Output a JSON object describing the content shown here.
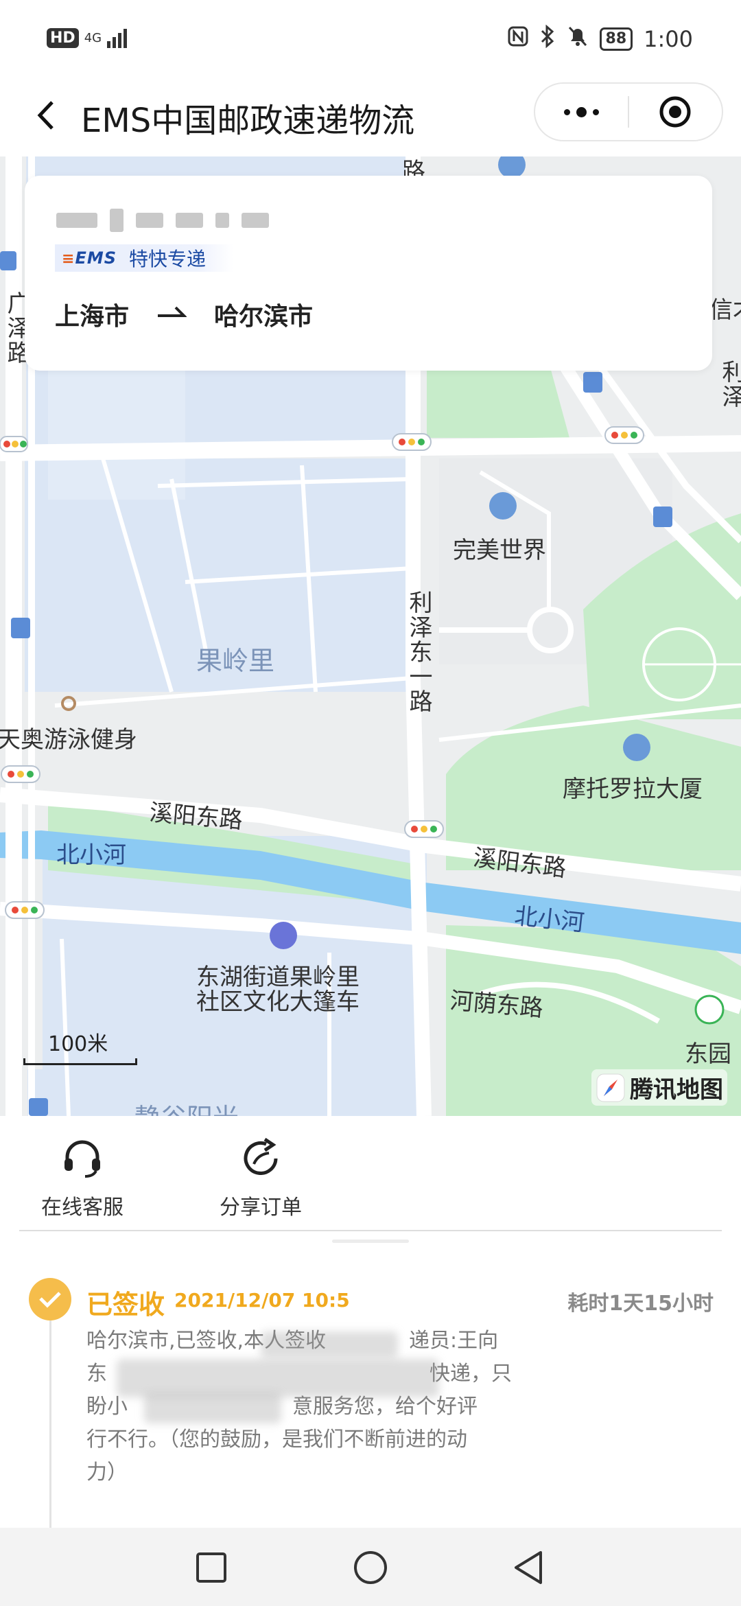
{
  "status_bar": {
    "hd": "HD",
    "network": "4G",
    "battery": "88",
    "time": "1:00"
  },
  "title_bar": {
    "title": "EMS中国邮政速递物流"
  },
  "route_card": {
    "service_logo": "EMS",
    "service_name": "特快专递",
    "origin": "上海市",
    "destination": "哈尔滨市"
  },
  "map": {
    "labels": {
      "road_top": "路",
      "guang_ze_lu": "广泽路",
      "xin": "信才",
      "li": "利泽",
      "wanmei": "完美世界",
      "guolingli": "果岭里",
      "lize_dong_yi_lu": "利泽东一路",
      "tianao": "天奥游泳健身",
      "motorola": "摩托罗拉大厦",
      "xiyang_1": "溪阳东路",
      "xiyang_2": "溪阳东路",
      "river_1": "北小河",
      "river_2": "北小河",
      "donghu": "东湖街道果岭里",
      "donghu_2": "社区文化大篷车",
      "heyin": "河荫东路",
      "dongyuan": "东园",
      "bottom": "静谷阳光"
    },
    "scale": "100米",
    "provider": "腾讯地图"
  },
  "actions": {
    "service": "在线客服",
    "share": "分享订单"
  },
  "timeline": {
    "status": "已签收",
    "time": "2021/12/07 10:5",
    "duration": "耗时1天15小时",
    "detail_lines": [
      "哈尔滨市,已签收,本人签收",
      "递员:王向",
      "东",
      "快递，只",
      "盼小",
      "意服务您，给个好评",
      "行不行。（您的鼓励，是我们不断前进的动",
      "力）"
    ]
  },
  "colors": {
    "accent": "#f0a91e",
    "ems_blue": "#1b4aa3",
    "water": "#8cc8f2",
    "green": "#c4ecc8",
    "block": "#dbe6f5"
  }
}
